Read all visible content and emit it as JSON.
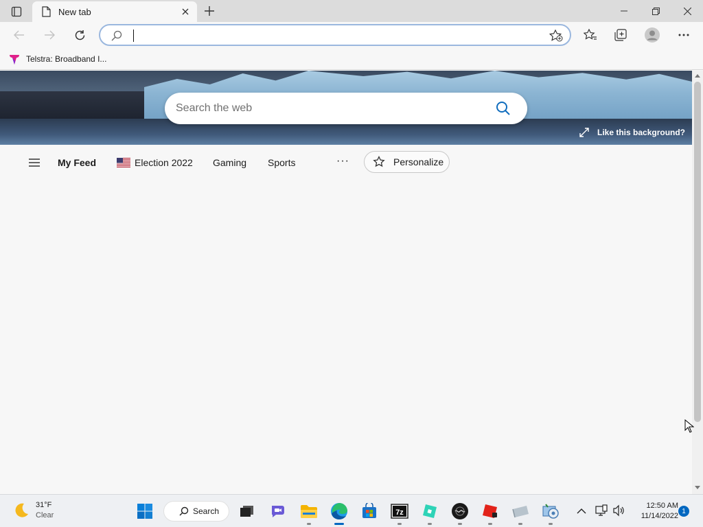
{
  "browser": {
    "tab": {
      "title": "New tab"
    },
    "address_bar": {
      "value": "",
      "placeholder": ""
    },
    "bookmarks": [
      {
        "label": "Telstra: Broadband I..."
      }
    ]
  },
  "newtab": {
    "search_placeholder": "Search the web",
    "like_background": "Like this background?",
    "nav": {
      "my_feed": "My Feed",
      "election": "Election 2022",
      "gaming": "Gaming",
      "sports": "Sports",
      "more": "···",
      "personalize": "Personalize"
    }
  },
  "taskbar": {
    "weather": {
      "temp": "31°F",
      "condition": "Clear"
    },
    "search_label": "Search",
    "apps": [
      "start-icon",
      "task-view-icon",
      "teams-chat-icon",
      "file-explorer-icon",
      "edge-icon",
      "store-icon",
      "7zip-icon",
      "app-icon-teal",
      "app-icon-dark",
      "app-icon-red",
      "app-icon-grey",
      "control-panel-icon"
    ],
    "time": "12:50 AM",
    "date": "11/14/2022",
    "notification_count": "1"
  },
  "colors": {
    "accent": "#0067c0",
    "search_icon": "#0f6cbd",
    "address_border": "#9ab7de"
  }
}
